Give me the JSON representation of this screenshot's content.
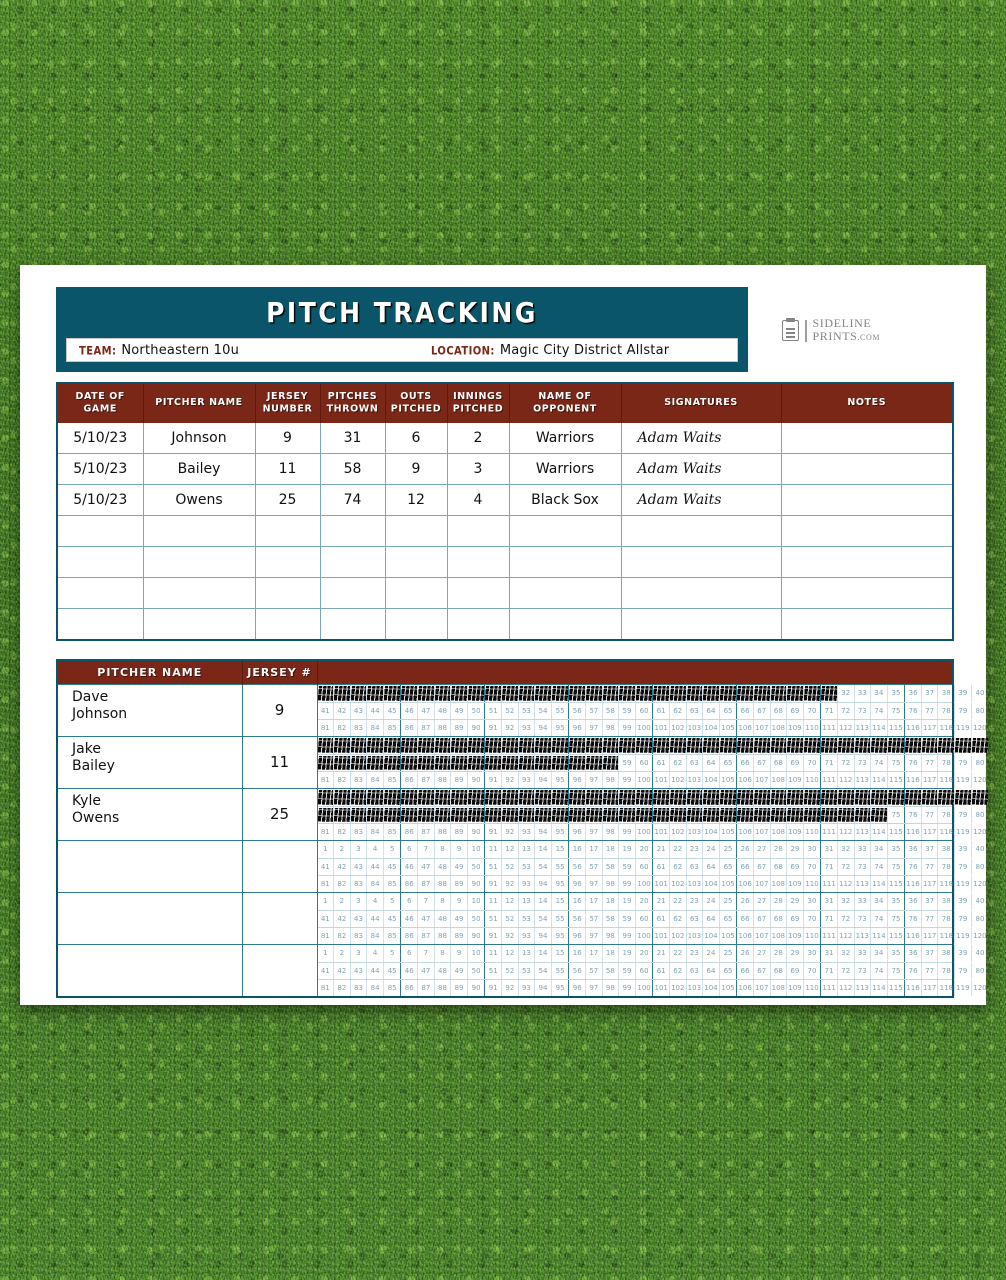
{
  "colors": {
    "teal": "#0a5569",
    "maroon": "#7a2717",
    "grid_line": "#2f7a90",
    "grass": "#4a8526"
  },
  "header": {
    "title": "PITCH TRACKING",
    "team_label": "TEAM:",
    "team_value": "Northeastern 10u",
    "location_label": "LOCATION:",
    "location_value": "Magic City District Allstar"
  },
  "logo": {
    "line1": "SIDELINE",
    "line2": "PRINTS",
    "domain": ".COM"
  },
  "game_log": {
    "columns": [
      "DATE OF GAME",
      "PITCHER NAME",
      "JERSEY NUMBER",
      "PITCHES THROWN",
      "OUTS PITCHED",
      "INNINGS PITCHED",
      "NAME OF OPPONENT",
      "SIGNATURES",
      "NOTES"
    ],
    "rows": [
      {
        "date": "5/10/23",
        "pitcher": "Johnson",
        "jersey": "9",
        "pitches": "31",
        "outs": "6",
        "innings": "2",
        "opponent": "Warriors",
        "signature": "Adam Waits",
        "notes": ""
      },
      {
        "date": "5/10/23",
        "pitcher": "Bailey",
        "jersey": "11",
        "pitches": "58",
        "outs": "9",
        "innings": "3",
        "opponent": "Warriors",
        "signature": "Adam Waits",
        "notes": ""
      },
      {
        "date": "5/10/23",
        "pitcher": "Owens",
        "jersey": "25",
        "pitches": "74",
        "outs": "12",
        "innings": "4",
        "opponent": "Black Sox",
        "signature": "Adam Waits",
        "notes": ""
      },
      {
        "date": "",
        "pitcher": "",
        "jersey": "",
        "pitches": "",
        "outs": "",
        "innings": "",
        "opponent": "",
        "signature": "",
        "notes": ""
      },
      {
        "date": "",
        "pitcher": "",
        "jersey": "",
        "pitches": "",
        "outs": "",
        "innings": "",
        "opponent": "",
        "signature": "",
        "notes": ""
      },
      {
        "date": "",
        "pitcher": "",
        "jersey": "",
        "pitches": "",
        "outs": "",
        "innings": "",
        "opponent": "",
        "signature": "",
        "notes": ""
      },
      {
        "date": "",
        "pitcher": "",
        "jersey": "",
        "pitches": "",
        "outs": "",
        "innings": "",
        "opponent": "",
        "signature": "",
        "notes": ""
      }
    ]
  },
  "pitch_count": {
    "columns": [
      "PITCHER NAME",
      "JERSEY #"
    ],
    "grid": {
      "max": 120,
      "per_row": 40,
      "group_size": 5,
      "rows_per_pitcher": 3
    },
    "pitchers": [
      {
        "first_name": "Dave",
        "last_name": "Johnson",
        "jersey": "9",
        "count": 31
      },
      {
        "first_name": "Jake",
        "last_name": "Bailey",
        "jersey": "11",
        "count": 58
      },
      {
        "first_name": "Kyle",
        "last_name": "Owens",
        "jersey": "25",
        "count": 74
      },
      {
        "first_name": "",
        "last_name": "",
        "jersey": "",
        "count": 0
      },
      {
        "first_name": "",
        "last_name": "",
        "jersey": "",
        "count": 0
      },
      {
        "first_name": "",
        "last_name": "",
        "jersey": "",
        "count": 0
      }
    ]
  }
}
